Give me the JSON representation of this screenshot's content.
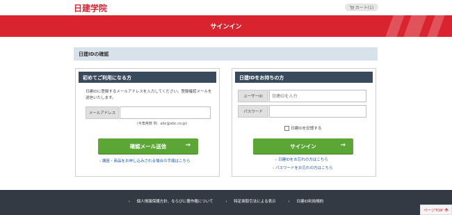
{
  "header": {
    "logo": "日建学院",
    "cart": {
      "icon": "cart-icon",
      "label": "カート(1)"
    }
  },
  "banner": {
    "title": "サインイン",
    "accent": "#d9232e"
  },
  "section": {
    "title": "日建IDの確認"
  },
  "new_user": {
    "title": "初めてご利用になる方",
    "description": "日建IDに登録するメールアドレスを入力してください。登録確認メールを送信いたします。",
    "email_label": "メールアドレス",
    "email_value": "",
    "email_note": "(半角英数 例：abc@abc.co.jp)",
    "button_label": "確認メール送信",
    "button_arrow": "→",
    "link_prefix": "›",
    "link_text": "講座・商品をお申し込みされる場合の手順はこちら"
  },
  "member": {
    "title": "日建IDをお持ちの方",
    "user_id_label": "ユーザーID",
    "user_id_placeholder": "日建IDを入力",
    "password_label": "パスワード",
    "password_value": "",
    "remember_label": "日建IDを記憶する",
    "button_label": "サインイン",
    "button_arrow": "→",
    "link_prefix": "›",
    "forgot_id": "日建IDをお忘れの方はこちら",
    "forgot_password": "パスワードをお忘れの方はこちら"
  },
  "footer": {
    "links": [
      "個人情報保護方針、ならびに著作権について",
      "特定商取引法による表示",
      "日建ID利用規約"
    ],
    "bullet": "›",
    "page_top": "ページTOP",
    "page_top_icon": "arrow-up-icon"
  },
  "colors": {
    "button": "#5ba634",
    "panel_header": "#384a5c",
    "footer": "#333a44",
    "section_header": "#d8e2ea"
  }
}
